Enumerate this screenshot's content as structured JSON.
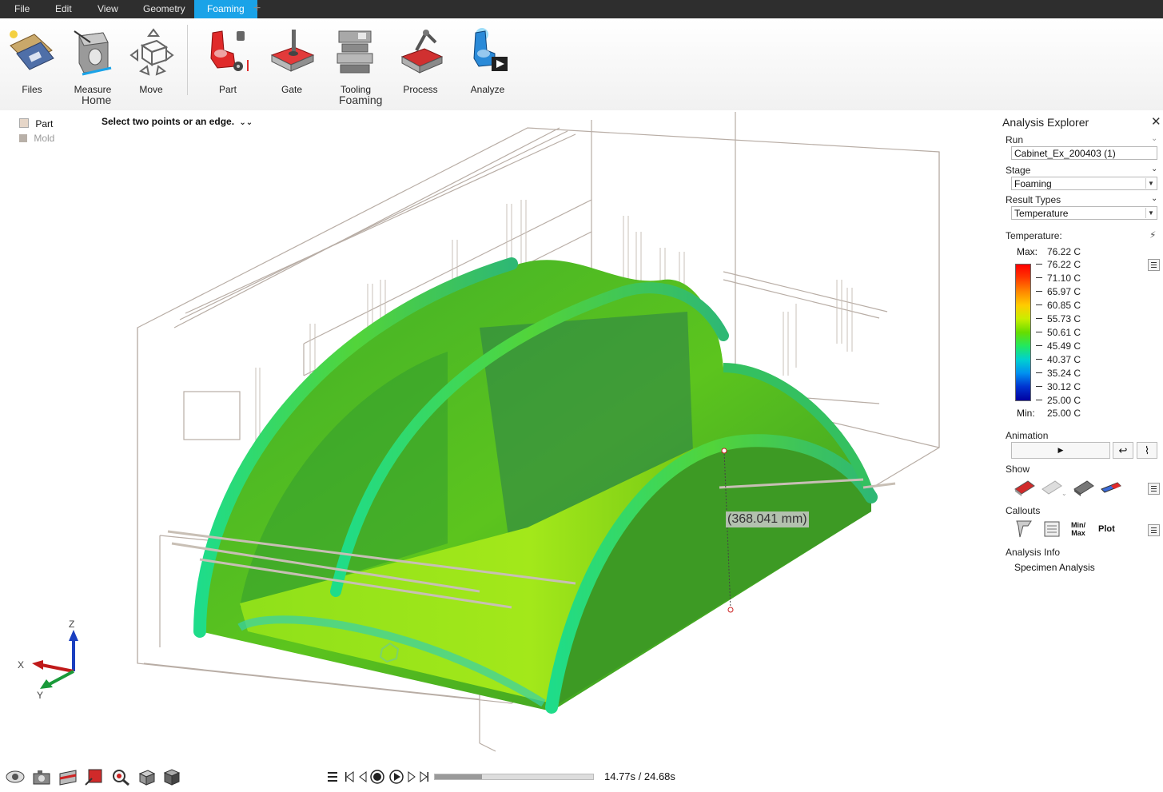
{
  "menu": {
    "items": [
      "File",
      "Edit",
      "View",
      "Geometry",
      "Foaming"
    ],
    "active": "Foaming"
  },
  "ribbon": {
    "tools": {
      "files": "Files",
      "measure": "Measure",
      "move": "Move",
      "part": "Part",
      "gate": "Gate",
      "tooling": "Tooling",
      "process": "Process",
      "analyze": "Analyze"
    },
    "groups": {
      "home": "Home",
      "foaming": "Foaming"
    }
  },
  "viewport": {
    "visibility": [
      {
        "label": "Part",
        "color": "#e6d6c8"
      },
      {
        "label": "Mold",
        "color": "#b8b0a8"
      }
    ],
    "hint": "Select two points or an edge.",
    "dimension": "(368.041 mm)",
    "axes": {
      "z": "Z",
      "x": "X",
      "y": "Y"
    }
  },
  "playback": {
    "time": "14.77s / 24.68s",
    "progress": 0.3
  },
  "panel": {
    "title": "Analysis Explorer",
    "run_label": "Run",
    "run_value": "Cabinet_Ex_200403 (1)",
    "stage_label": "Stage",
    "stage_value": "Foaming",
    "result_label": "Result Types",
    "result_value": "Temperature",
    "temp_label": "Temperature:",
    "max_label": "Max:",
    "max_value": "76.22 C",
    "min_label": "Min:",
    "min_value": "25.00 C",
    "scale": [
      "76.22 C",
      "71.10 C",
      "65.97 C",
      "60.85 C",
      "55.73 C",
      "50.61 C",
      "45.49 C",
      "40.37 C",
      "35.24 C",
      "30.12 C",
      "25.00 C"
    ],
    "animation_label": "Animation",
    "show_label": "Show",
    "callouts_label": "Callouts",
    "minmax_label": "Min/\nMax",
    "plot_label": "Plot",
    "info_label": "Analysis Info",
    "info_value": "Specimen Analysis"
  },
  "colors": {
    "accent": "#1aa3e8",
    "menubar": "#2e2e2e"
  }
}
